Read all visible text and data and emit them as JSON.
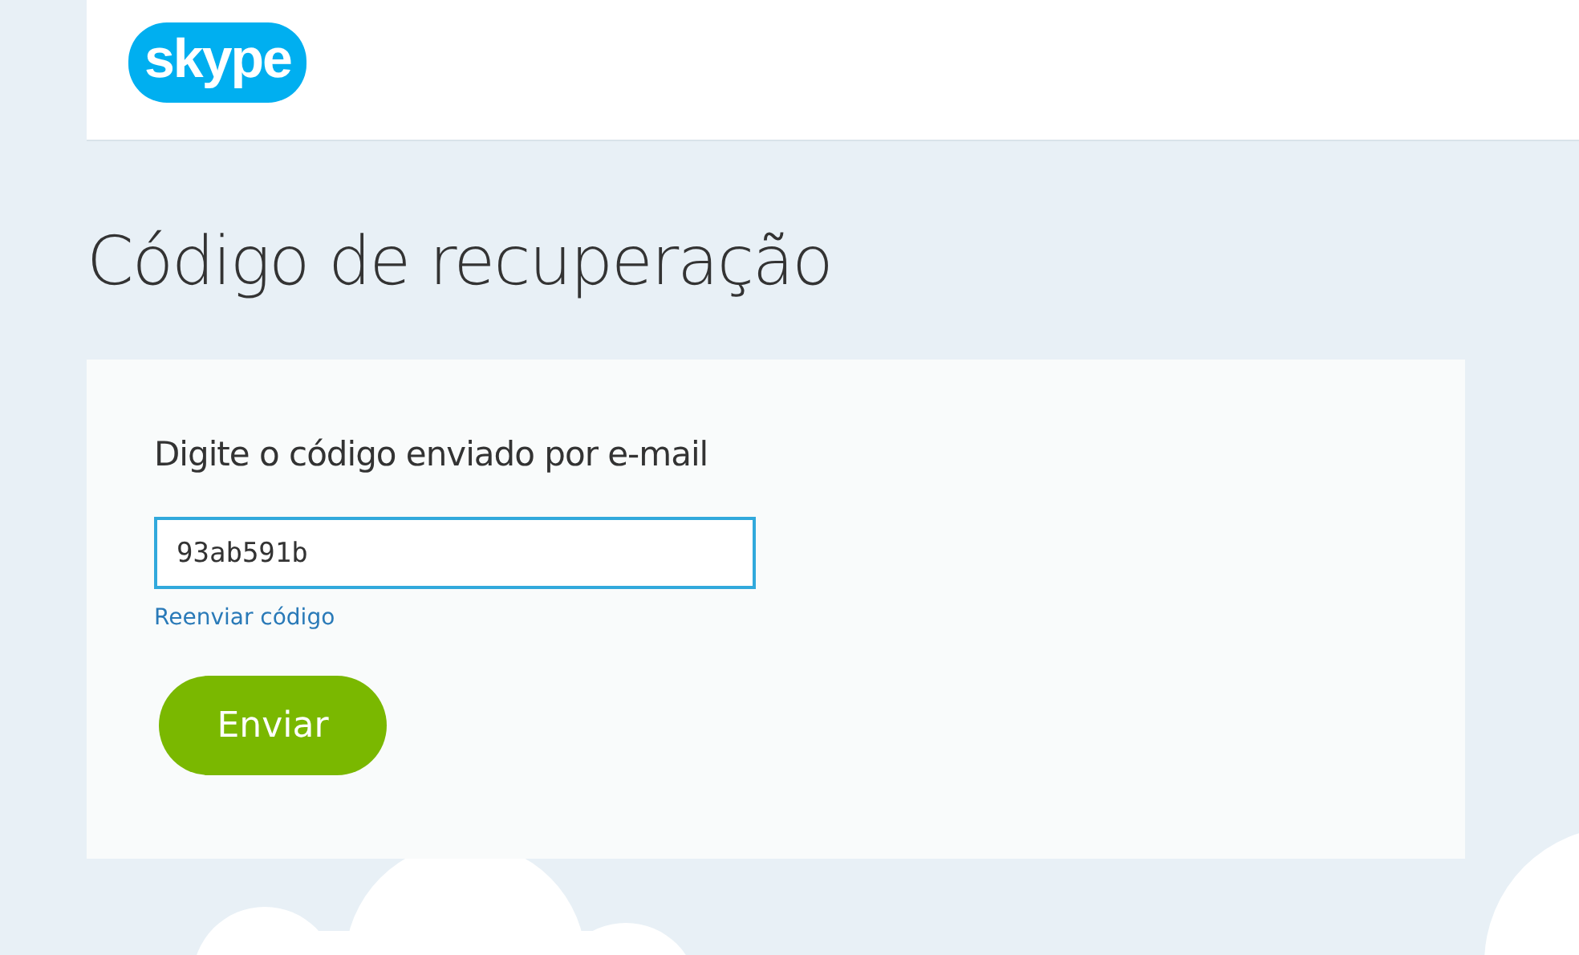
{
  "header": {
    "logo": "skype"
  },
  "title": "Código de recuperação",
  "form": {
    "label": "Digite o código enviado por e-mail",
    "code_field": {
      "value": "93ab591b"
    },
    "resend_link": "Reenviar código",
    "submit_button": "Enviar"
  }
}
